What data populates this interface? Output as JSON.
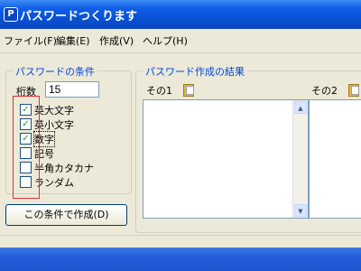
{
  "window": {
    "title": "パスワードつくります",
    "app_icon": "P"
  },
  "menu": [
    {
      "label": "ファイル(F)"
    },
    {
      "label": "編集(E)"
    },
    {
      "label": "作成(V)"
    },
    {
      "label": "ヘルプ(H)"
    }
  ],
  "conditions": {
    "group_title": "パスワードの条件",
    "digits_label": "桁数",
    "digits_value": "15",
    "options": [
      {
        "label": "英大文字",
        "checked": true
      },
      {
        "label": "英小文字",
        "checked": true
      },
      {
        "label": "数字",
        "checked": true
      },
      {
        "label": "記号",
        "checked": false
      },
      {
        "label": "半角カタカナ",
        "checked": false
      },
      {
        "label": "ランダム",
        "checked": false
      }
    ],
    "create_button": "この条件で作成(D)"
  },
  "results": {
    "group_title": "パスワード作成の結果",
    "columns": [
      {
        "label": "その1"
      },
      {
        "label": "その2"
      }
    ]
  },
  "colors": {
    "titlebar": "#0a4fd0",
    "group_title": "#0046d5",
    "highlight_box": "#e03030",
    "check": "#21a121"
  }
}
